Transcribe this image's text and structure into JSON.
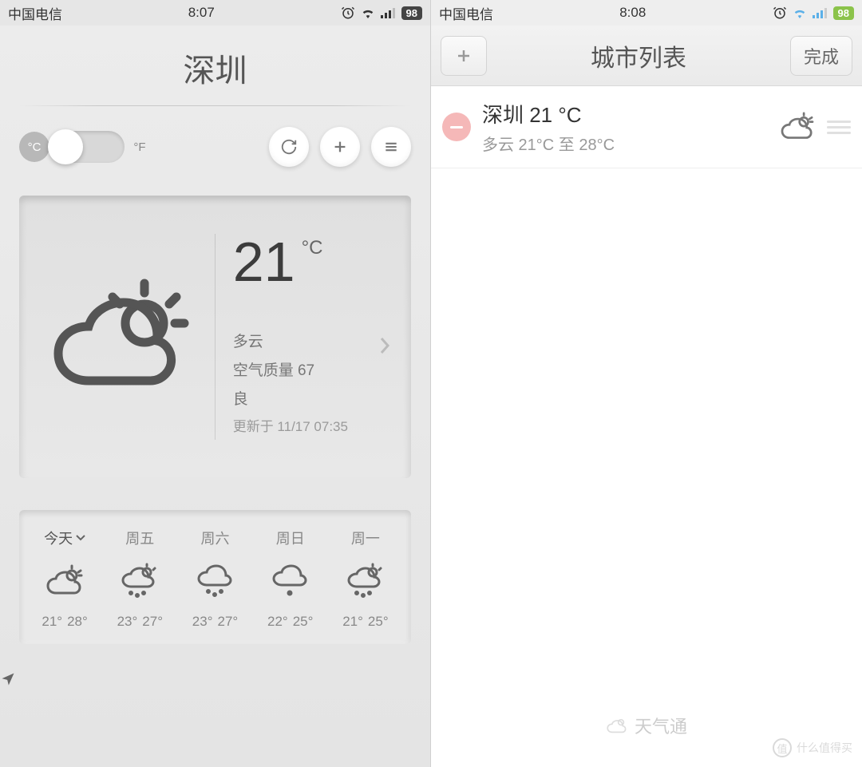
{
  "left": {
    "status": {
      "carrier": "中国电信",
      "time": "8:07",
      "battery": "98"
    },
    "city": "深圳",
    "unit_c": "°C",
    "unit_f": "°F",
    "current": {
      "temp": "21",
      "unit": "°C",
      "condition": "多云",
      "aqi_label": "空气质量 67",
      "aqi_grade": "良",
      "updated": "更新于 11/17 07:35"
    },
    "forecast": [
      {
        "day": "今天",
        "lo": "21°",
        "hi": "28°"
      },
      {
        "day": "周五",
        "lo": "23°",
        "hi": "27°"
      },
      {
        "day": "周六",
        "lo": "23°",
        "hi": "27°"
      },
      {
        "day": "周日",
        "lo": "22°",
        "hi": "25°"
      },
      {
        "day": "周一",
        "lo": "21°",
        "hi": "25°"
      }
    ]
  },
  "right": {
    "status": {
      "carrier": "中国电信",
      "time": "8:08",
      "battery": "98"
    },
    "header_title": "城市列表",
    "done_label": "完成",
    "row": {
      "title": "深圳 21 °C",
      "subtitle": "多云 21°C 至 28°C"
    },
    "brand": "天气通"
  },
  "watermark": "什么值得买"
}
